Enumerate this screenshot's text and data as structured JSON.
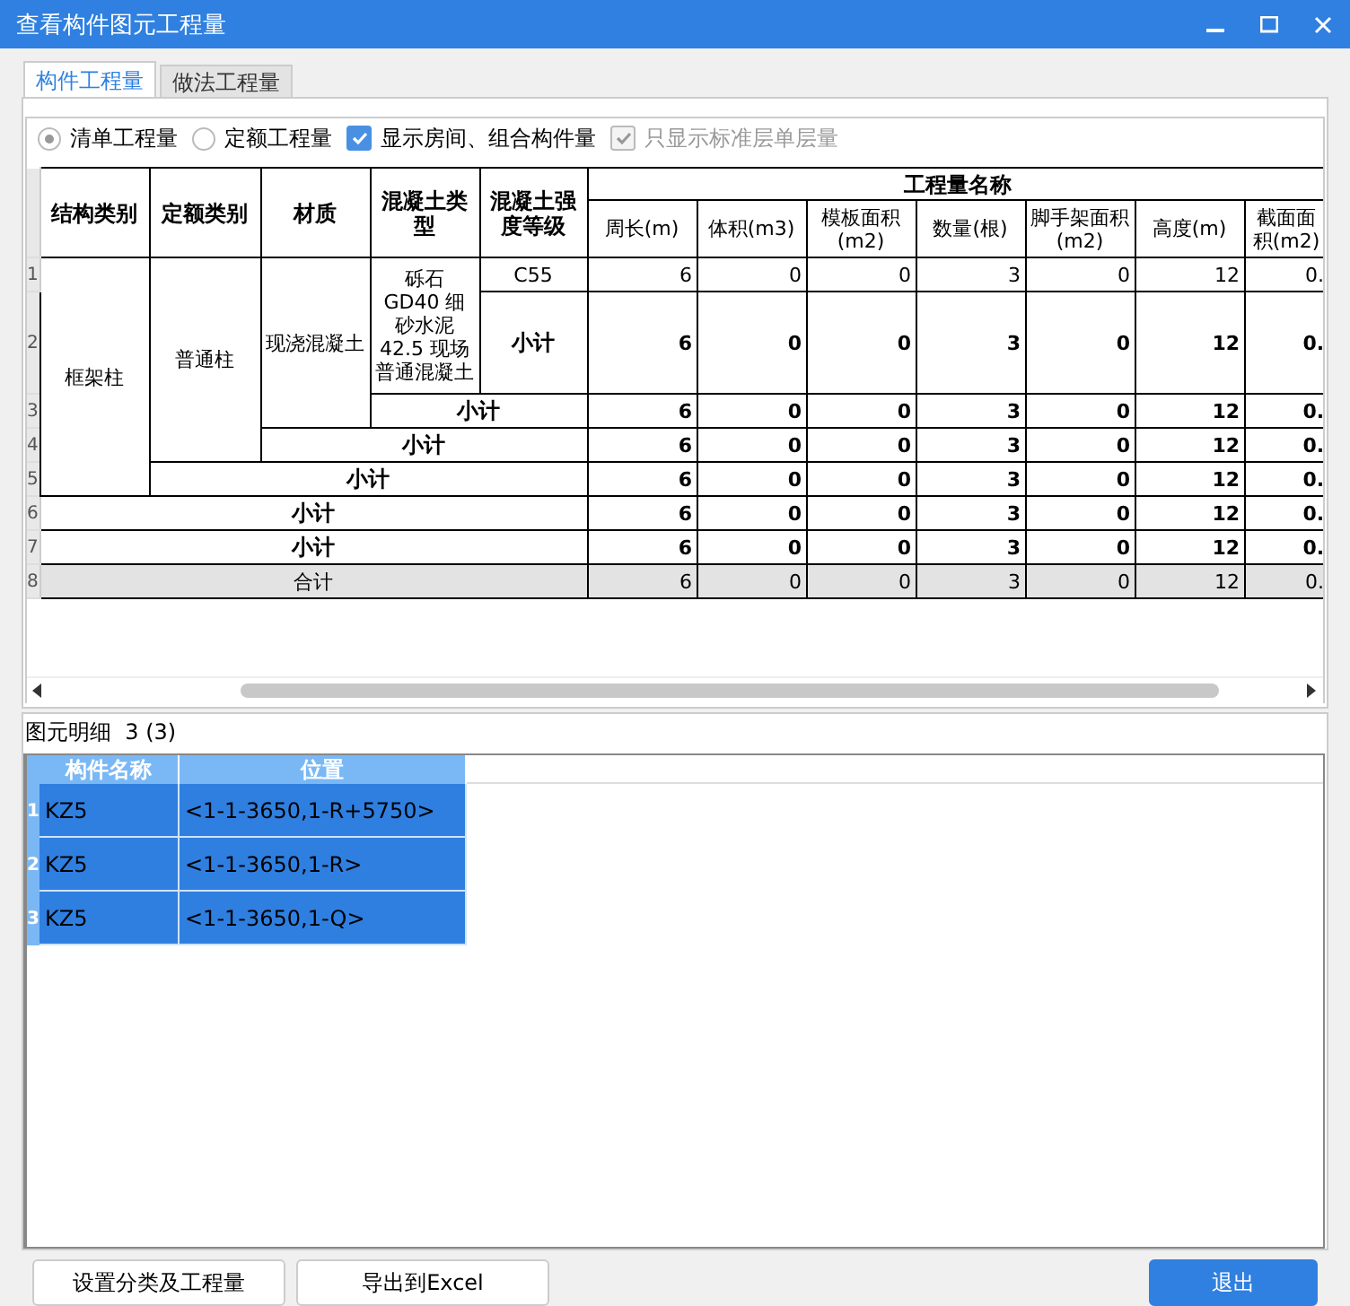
{
  "window": {
    "title": "查看构件图元工程量"
  },
  "tabs": [
    {
      "label": "构件工程量",
      "selected": true
    },
    {
      "label": "做法工程量",
      "selected": false
    }
  ],
  "options": [
    {
      "kind": "radio",
      "label": "清单工程量",
      "selected": true
    },
    {
      "kind": "radio",
      "label": "定额工程量",
      "selected": false
    },
    {
      "kind": "checkbox",
      "label": "显示房间、组合构件量",
      "checked": true,
      "disabled": false
    },
    {
      "kind": "checkbox",
      "label": "只显示标准层单层量",
      "checked": true,
      "disabled": true
    }
  ],
  "quantity_table": {
    "group_title": "工程量名称",
    "label_columns": [
      "结构类别",
      "定额类别",
      "材质",
      "混凝土类型",
      "混凝土强度等级"
    ],
    "value_columns": [
      "周长(m)",
      "体积(m3)",
      "模板面积(m2)",
      "数量(根)",
      "脚手架面积(m2)",
      "高度(m)",
      "截面面积(m2)"
    ],
    "rows": [
      {
        "number": "1",
        "kind": "detail",
        "labels": [
          {
            "text": "框架柱"
          },
          {
            "text": "普通柱"
          },
          {
            "text": "现浇混凝土"
          },
          {
            "text": "砾石 GD40 细砂水泥42.5 现场普通混凝土"
          },
          {
            "text": "C55"
          }
        ],
        "values": [
          "6",
          "0",
          "0",
          "3",
          "0",
          "12",
          "0."
        ]
      },
      {
        "number": "2",
        "kind": "subtotal",
        "labels": [
          {
            "text": "小计"
          }
        ],
        "values": [
          "6",
          "0",
          "0",
          "3",
          "0",
          "12",
          "0."
        ]
      },
      {
        "number": "3",
        "kind": "subtotal",
        "labels": [
          {
            "text": "小计"
          }
        ],
        "values": [
          "6",
          "0",
          "0",
          "3",
          "0",
          "12",
          "0."
        ]
      },
      {
        "number": "4",
        "kind": "subtotal",
        "labels": [
          {
            "text": "小计"
          }
        ],
        "values": [
          "6",
          "0",
          "0",
          "3",
          "0",
          "12",
          "0."
        ]
      },
      {
        "number": "5",
        "kind": "subtotal",
        "labels": [
          {
            "text": "小计"
          }
        ],
        "values": [
          "6",
          "0",
          "0",
          "3",
          "0",
          "12",
          "0."
        ]
      },
      {
        "number": "6",
        "kind": "subtotal",
        "labels": [
          {
            "text": "小计"
          }
        ],
        "values": [
          "6",
          "0",
          "0",
          "3",
          "0",
          "12",
          "0."
        ]
      },
      {
        "number": "7",
        "kind": "subtotal",
        "labels": [
          {
            "text": "小计"
          }
        ],
        "values": [
          "6",
          "0",
          "0",
          "3",
          "0",
          "12",
          "0."
        ]
      },
      {
        "number": "8",
        "kind": "total",
        "labels": [
          {
            "text": "合计"
          }
        ],
        "values": [
          "6",
          "0",
          "0",
          "3",
          "0",
          "12",
          "0."
        ]
      }
    ]
  },
  "detail": {
    "title": "图元明细",
    "count": "3 (3)",
    "columns": [
      "构件名称",
      "位置"
    ],
    "rows": [
      {
        "number": "1",
        "name": "KZ5",
        "position": "<1-1-3650,1-R+5750>",
        "selected": true
      },
      {
        "number": "2",
        "name": "KZ5",
        "position": "<1-1-3650,1-R>",
        "selected": true
      },
      {
        "number": "3",
        "name": "KZ5",
        "position": "<1-1-3650,1-Q>",
        "selected": true
      }
    ]
  },
  "buttons": [
    {
      "label": "设置分类及工程量",
      "kind": "default"
    },
    {
      "label": "导出到Excel",
      "kind": "default"
    },
    {
      "label": "退出",
      "kind": "primary"
    }
  ]
}
